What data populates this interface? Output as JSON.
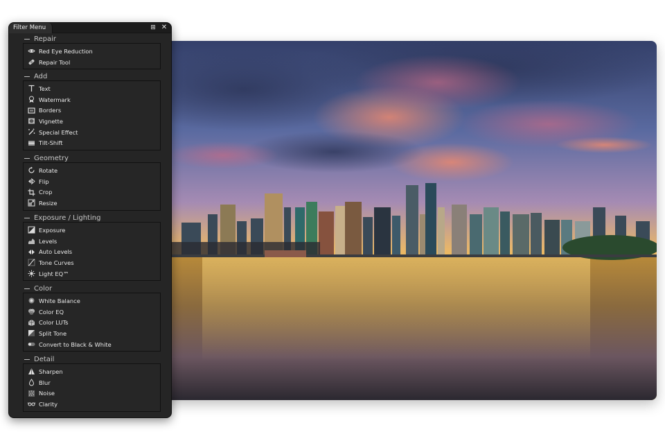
{
  "panel": {
    "title": "Filter Menu",
    "pin_glyph": "⊞",
    "close_glyph": "✕",
    "sections": [
      {
        "title": "Repair",
        "items": [
          {
            "label": "Red Eye Reduction",
            "icon": "eye-icon"
          },
          {
            "label": "Repair Tool",
            "icon": "bandage-icon"
          }
        ]
      },
      {
        "title": "Add",
        "items": [
          {
            "label": "Text",
            "icon": "text-icon"
          },
          {
            "label": "Watermark",
            "icon": "watermark-icon"
          },
          {
            "label": "Borders",
            "icon": "borders-icon"
          },
          {
            "label": "Vignette",
            "icon": "vignette-icon"
          },
          {
            "label": "Special Effect",
            "icon": "magic-wand-icon"
          },
          {
            "label": "Tilt-Shift",
            "icon": "tilt-shift-icon"
          }
        ]
      },
      {
        "title": "Geometry",
        "items": [
          {
            "label": "Rotate",
            "icon": "rotate-icon"
          },
          {
            "label": "Flip",
            "icon": "flip-icon"
          },
          {
            "label": "Crop",
            "icon": "crop-icon"
          },
          {
            "label": "Resize",
            "icon": "resize-icon"
          }
        ]
      },
      {
        "title": "Exposure / Lighting",
        "items": [
          {
            "label": "Exposure",
            "icon": "exposure-icon"
          },
          {
            "label": "Levels",
            "icon": "levels-icon"
          },
          {
            "label": "Auto Levels",
            "icon": "auto-levels-icon"
          },
          {
            "label": "Tone Curves",
            "icon": "tone-curves-icon"
          },
          {
            "label": "Light EQ™",
            "icon": "light-eq-icon"
          }
        ]
      },
      {
        "title": "Color",
        "items": [
          {
            "label": "White Balance",
            "icon": "white-balance-icon"
          },
          {
            "label": "Color EQ",
            "icon": "color-eq-icon"
          },
          {
            "label": "Color LUTs",
            "icon": "color-luts-icon"
          },
          {
            "label": "Split Tone",
            "icon": "split-tone-icon"
          },
          {
            "label": "Convert to Black & White",
            "icon": "black-white-icon"
          }
        ]
      },
      {
        "title": "Detail",
        "items": [
          {
            "label": "Sharpen",
            "icon": "sharpen-icon"
          },
          {
            "label": "Blur",
            "icon": "blur-drop-icon"
          },
          {
            "label": "Noise",
            "icon": "noise-icon"
          },
          {
            "label": "Clarity",
            "icon": "clarity-glasses-icon"
          }
        ]
      }
    ]
  },
  "colors": {
    "panel_bg": "#252525",
    "text": "#eaeaea",
    "section_header": "#c7c7c7",
    "sky_top": "#3b4a6e",
    "sunset_glow": "#f5c33b"
  }
}
